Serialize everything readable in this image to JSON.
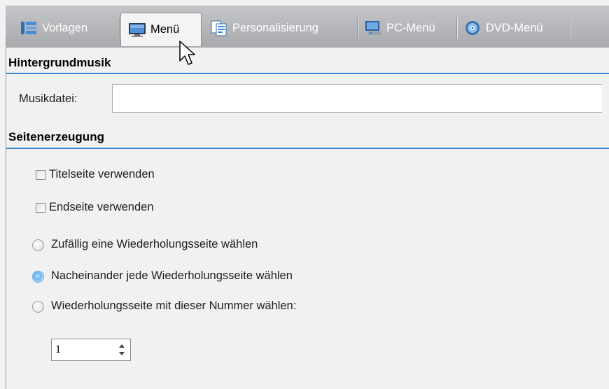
{
  "tabs": [
    {
      "label": "Vorlagen",
      "icon": "templates-icon",
      "active": false
    },
    {
      "label": "Menü",
      "icon": "monitor-icon",
      "active": true
    },
    {
      "label": "Personalisierung",
      "icon": "documents-icon",
      "active": false
    },
    {
      "label": "PC-Menü",
      "icon": "computer-icon",
      "active": false
    },
    {
      "label": "DVD-Menü",
      "icon": "dvd-icon",
      "active": false
    }
  ],
  "background_music": {
    "title": "Hintergrundmusik",
    "music_file_label": "Musikdatei:",
    "music_file_value": ""
  },
  "page_generation": {
    "title": "Seitenerzeugung",
    "title_page_label": "Titelseite verwenden",
    "title_page_checked": false,
    "end_page_label": "Endseite verwenden",
    "end_page_checked": false,
    "radio_random_label": "Zufällig eine Wiederholungsseite wählen",
    "radio_sequential_label": "Nacheinander jede Wiederholungsseite wählen",
    "radio_number_label": "Wiederholungsseite mit dieser Nummer wählen:",
    "selected_option": "sequential",
    "page_number_value": "1"
  },
  "colors": {
    "accent_line": "#3c86d6",
    "tab_bar": "#b3b5b8",
    "selected_radio": "#62b3ef"
  }
}
